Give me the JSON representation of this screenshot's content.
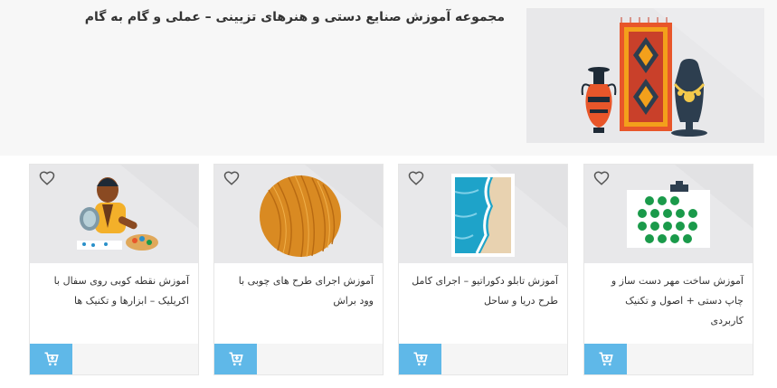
{
  "hero": {
    "title": "مجموعه آموزش صنایع دستی و هنرهای تزیینی – عملی و گام به گام",
    "image_icon": "crafts-illustration-icon"
  },
  "cards": [
    {
      "title": "آموزش ساخت مهر دست ساز و چاپ دستی + اصول و تکنیک کاربردی",
      "image_icon": "hand-stamp-print-icon"
    },
    {
      "title": "آموزش تابلو دکوراتیو – اجرای کامل طرح دریا و ساحل",
      "image_icon": "sea-beach-painting-icon"
    },
    {
      "title": "آموزش اجرای طرح های چوبی با وود براش",
      "image_icon": "wood-texture-icon"
    },
    {
      "title": "آموزش نقطه کوبی روی سفال با اکریلیک – ابزارها و تکنیک ها",
      "image_icon": "pottery-painting-icon"
    }
  ],
  "colors": {
    "cart": "#5fb8e8",
    "hero_bg": "#f7f7f7",
    "card_img_bg": "#e2e2e4"
  }
}
